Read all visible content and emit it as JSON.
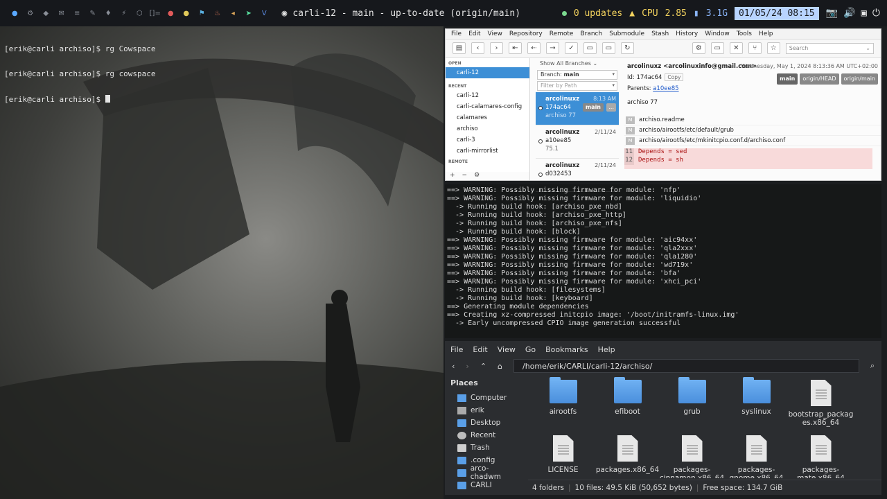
{
  "topbar": {
    "tag_icons": [
      "arch-icon",
      "circle-icon",
      "shield-icon",
      "mail-icon",
      "list-icon",
      "wrench-icon",
      "drop-icon",
      "bolt-icon",
      "gear-icon",
      "bracket-icon",
      "red-icon",
      "dot-icon",
      "pin-icon",
      "fire-icon",
      "speaker-icon",
      "send-icon",
      "v-icon"
    ],
    "window_title": "carli-12 - main - up-to-date (origin/main)",
    "updates": "0 updates",
    "cpu_label": "CPU",
    "cpu_value": "2.85",
    "mem_value": "3.1G",
    "datetime": "01/05/24 08:15"
  },
  "terminal1": {
    "lines": [
      "[erik@carli archiso]$ rg Cowspace",
      "[erik@carli archiso]$ rg cowspace",
      "[erik@carli archiso]$ "
    ]
  },
  "sourcetree": {
    "menu": [
      "File",
      "Edit",
      "View",
      "Repository",
      "Remote",
      "Branch",
      "Submodule",
      "Stash",
      "History",
      "Window",
      "Tools",
      "Help"
    ],
    "search_placeholder": "Search",
    "sidebar": {
      "open_label": "OPEN",
      "open_items": [
        "carli-12"
      ],
      "recent_label": "RECENT",
      "recent_items": [
        "carli-12",
        "carli-calamares-config",
        "calamares",
        "archiso",
        "carli-3",
        "carli-mirrorlist"
      ],
      "remote_label": "REMOTE"
    },
    "branch_filter": "Show All Branches",
    "branch_label": "Branch:",
    "branch_value": "main",
    "path_filter": "Filter by Path",
    "commits": [
      {
        "author": "arcolinuxz",
        "hash": "174ac64",
        "msg": "archiso 77",
        "date": "8:13 AM",
        "badge": "main",
        "more": "..."
      },
      {
        "author": "arcolinuxz",
        "hash": "a10ee85",
        "msg": "75.1",
        "date": "2/11/24"
      },
      {
        "author": "arcolinuxz",
        "hash": "d032453",
        "msg": "",
        "date": "2/11/24"
      }
    ],
    "detail": {
      "author": "arcolinuxz <arcolinuxinfo@gmail.com>",
      "date": "Wednesday, May 1, 2024 8:13:36 AM UTC+02:00",
      "id_label": "Id:",
      "id": "174ac64",
      "copy": "Copy",
      "parents_label": "Parents:",
      "parent": "a10ee85",
      "tags": [
        "main",
        "origin/HEAD",
        "origin/main"
      ],
      "message": "archiso 77",
      "files": [
        "archiso.readme",
        "archiso/airootfs/etc/default/grub",
        "archiso/airootfs/etc/mkinitcpio.conf.d/archiso.conf"
      ],
      "file_status": "M",
      "diff": [
        {
          "n": "11",
          "t": "Depends = sed"
        },
        {
          "n": "12",
          "t": "Depends = sh"
        }
      ]
    }
  },
  "terminal2": {
    "lines": [
      "==> WARNING: Possibly missing firmware for module: 'nfp'",
      "==> WARNING: Possibly missing firmware for module: 'liquidio'",
      "  -> Running build hook: [archiso_pxe_nbd]",
      "  -> Running build hook: [archiso_pxe_http]",
      "  -> Running build hook: [archiso_pxe_nfs]",
      "  -> Running build hook: [block]",
      "==> WARNING: Possibly missing firmware for module: 'aic94xx'",
      "==> WARNING: Possibly missing firmware for module: 'qla2xxx'",
      "==> WARNING: Possibly missing firmware for module: 'qla1280'",
      "==> WARNING: Possibly missing firmware for module: 'wd719x'",
      "==> WARNING: Possibly missing firmware for module: 'bfa'",
      "==> WARNING: Possibly missing firmware for module: 'xhci_pci'",
      "  -> Running build hook: [filesystems]",
      "  -> Running build hook: [keyboard]",
      "==> Generating module dependencies",
      "==> Creating xz-compressed initcpio image: '/boot/initramfs-linux.img'",
      "  -> Early uncompressed CPIO image generation successful"
    ]
  },
  "filemanager": {
    "menu": [
      "File",
      "Edit",
      "View",
      "Go",
      "Bookmarks",
      "Help"
    ],
    "path": "/home/erik/CARLI/carli-12/archiso/",
    "places_title": "Places",
    "places": [
      {
        "label": "Computer",
        "icon": "computer-icon"
      },
      {
        "label": "erik",
        "icon": "home-icon"
      },
      {
        "label": "Desktop",
        "icon": "folder-icon"
      },
      {
        "label": "Recent",
        "icon": "clock-icon"
      },
      {
        "label": "Trash",
        "icon": "trash-icon"
      },
      {
        "label": ".config",
        "icon": "folder-icon"
      },
      {
        "label": "arco-chadwm",
        "icon": "folder-icon"
      },
      {
        "label": "CARLI",
        "icon": "folder-icon"
      }
    ],
    "items": [
      {
        "label": "airootfs",
        "kind": "folder"
      },
      {
        "label": "efiboot",
        "kind": "folder"
      },
      {
        "label": "grub",
        "kind": "folder"
      },
      {
        "label": "syslinux",
        "kind": "folder"
      },
      {
        "label": "bootstrap_packag es.x86_64",
        "kind": "file"
      },
      {
        "label": "LICENSE",
        "kind": "file"
      },
      {
        "label": "packages.x86_64",
        "kind": "file"
      },
      {
        "label": "packages- cinnamon.x86_64",
        "kind": "file"
      },
      {
        "label": "packages- gnome.x86_64",
        "kind": "file"
      },
      {
        "label": "packages- mate.x86_64",
        "kind": "file"
      }
    ],
    "status_folders": "4 folders",
    "status_files": "10 files: 49.5 KiB (50,652 bytes)",
    "status_free": "Free space: 134.7 GiB"
  }
}
